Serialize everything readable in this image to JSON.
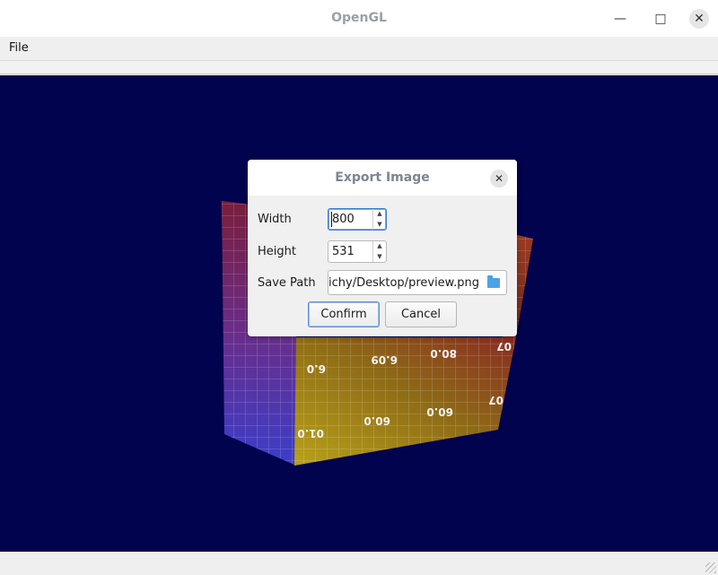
{
  "window": {
    "title": "OpenGL",
    "min_icon": "minimize-icon",
    "max_icon": "maximize-icon",
    "close_icon": "close-icon"
  },
  "menu": {
    "file_label": "File"
  },
  "cube_labels": [
    "6.0",
    "6.09",
    "80.0",
    "07",
    "01.0",
    "60.0",
    "60.0",
    "80.0",
    "07"
  ],
  "dialog": {
    "title": "Export Image",
    "width_label": "Width",
    "width_value": "800",
    "height_label": "Height",
    "height_value": "531",
    "path_label": "Save Path",
    "path_value": "C:/Users/nichy/Desktop/preview.png",
    "confirm_label": "Confirm",
    "cancel_label": "Cancel"
  },
  "colors": {
    "gl_background": "#02034e",
    "accent": "#3a7bd5"
  }
}
